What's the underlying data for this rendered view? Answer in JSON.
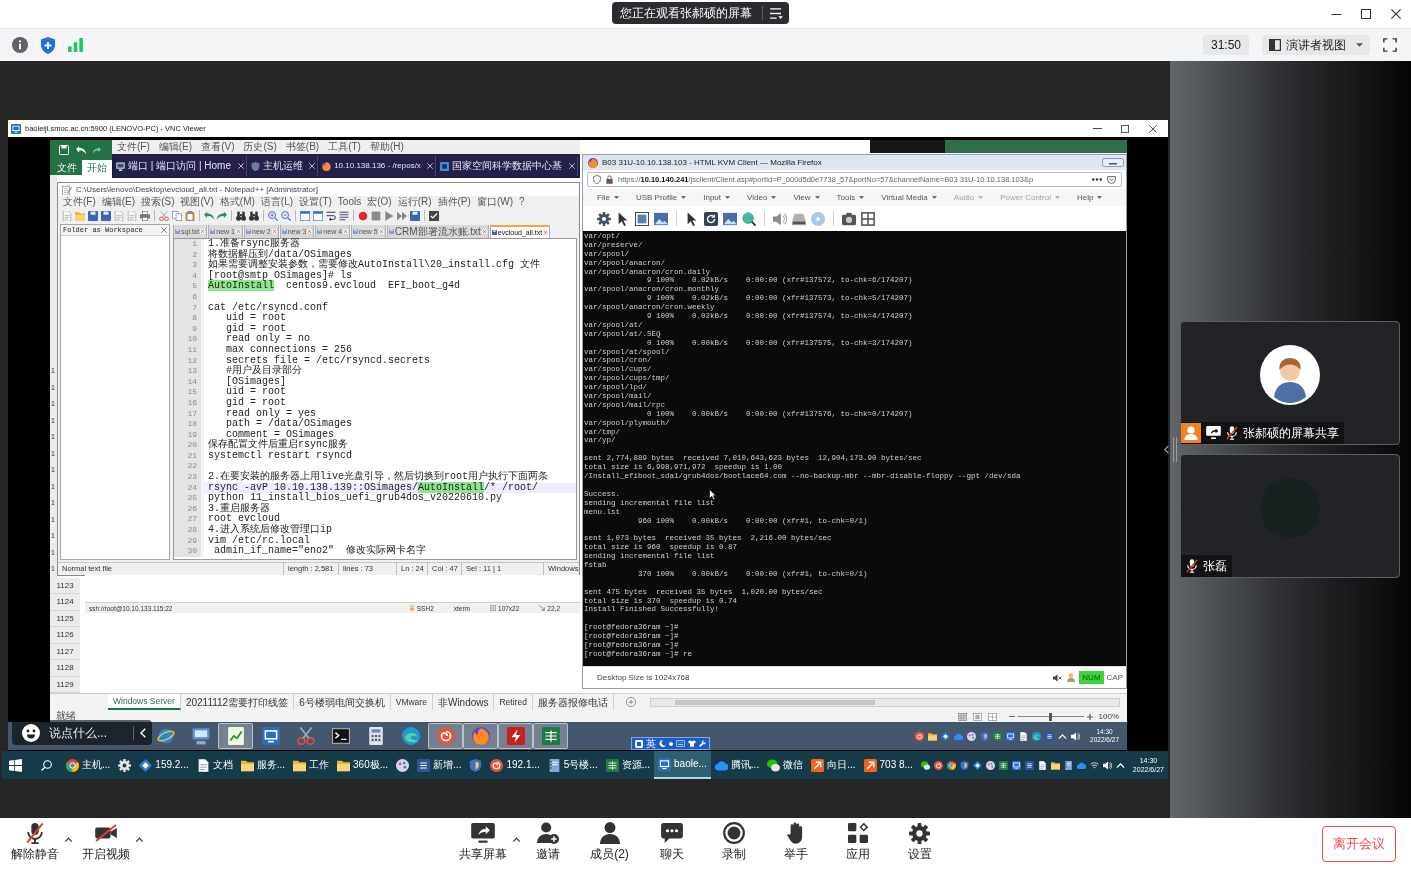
{
  "window": {
    "banner": "您正在观看张郝硕的屏幕"
  },
  "toolbar": {
    "timer": "31:50",
    "view_menu": "演讲者视图"
  },
  "shared_screen": {
    "vnc_window": {
      "title": "baoleiji.smoc.ac.cn:5900 (LENOVO-PC) - VNC Viewer"
    },
    "excel": {
      "ribbon_tabs": [
        {
          "label": "文件",
          "selected": false
        },
        {
          "label": "开始",
          "selected": true
        }
      ],
      "edge_row_numbers": [
        "1",
        "1",
        "1",
        "1",
        "1",
        "1",
        "1",
        "1",
        "1",
        "1",
        "1",
        "1",
        "1"
      ],
      "row_numbers": [
        "1123",
        "1124",
        "1125",
        "1126",
        "1127",
        "1128",
        "1129"
      ],
      "sheet_tabs": [
        {
          "label": "Windows Server",
          "selected": true
        },
        {
          "label": "20211112需要打印线签",
          "selected": false
        },
        {
          "label": "6号楼弱电间交换机",
          "selected": false
        },
        {
          "label": "VMware",
          "selected": false
        },
        {
          "label": "非Windows",
          "selected": false
        },
        {
          "label": "Retired",
          "selected": false
        },
        {
          "label": "服务器报修电话",
          "selected": false
        }
      ],
      "status": "就绪",
      "zoom_slider": {
        "level": 0.5
      },
      "zoom": "100%"
    },
    "browser": {
      "menu": [
        "文件(F)",
        "编辑(E)",
        "查看(V)",
        "历史(S)",
        "书签(B)",
        "工具(T)",
        "帮助(H)"
      ],
      "tabs": [
        {
          "title": "端口 | 端口访问 | Home",
          "kind": "monitor"
        },
        {
          "title": "主机运维",
          "kind": "shield"
        },
        {
          "title": "10.10.138.136 - /repos/x",
          "kind": "flame"
        },
        {
          "title": "国家空间科学数据中心基",
          "kind": "square"
        }
      ]
    },
    "notepad": {
      "title": "C:\\Users\\lenovo\\Desktop\\evcloud_all.txt - Notepad++ [Administrator]",
      "menu": [
        "文件(F)",
        "编辑(E)",
        "搜索(S)",
        "视图(V)",
        "格式(M)",
        "语言(L)",
        "设置(T)",
        "Tools",
        "宏(O)",
        "运行(R)",
        "插件(P)",
        "窗口(W)",
        "?"
      ],
      "panel_title": "Folder as Workspace",
      "tabs": [
        {
          "label": "sql.txt",
          "selected": false
        },
        {
          "label": "new 1",
          "selected": false
        },
        {
          "label": "new 2",
          "selected": false
        },
        {
          "label": "new 3",
          "selected": false
        },
        {
          "label": "new 4",
          "selected": false
        },
        {
          "label": "new 5",
          "selected": false
        },
        {
          "label": "CRM部署流水账.txt",
          "selected": false
        },
        {
          "label": "evcloud_all.txt",
          "selected": true
        }
      ],
      "lines": [
        {
          "no": "1",
          "text": "1.准备rsync服务器",
          "current": false
        },
        {
          "no": "2",
          "text": "将数据解压到/data/OSimages",
          "current": false
        },
        {
          "no": "3",
          "text": "如果需要调整安装参数，需要修改AutoInstall\\20_install.cfg 文件",
          "current": false
        },
        {
          "no": "4",
          "text": "[root@smtp OSimages]# ls",
          "current": false
        },
        {
          "no": "5",
          "parts": [
            {
              "text": "AutoInstall",
              "marked": true
            },
            {
              "text": "  centos9.evcloud  EFI_boot_g4d",
              "marked": false
            }
          ],
          "current": false
        },
        {
          "no": "6",
          "current": false
        },
        {
          "no": "7",
          "text": "cat /etc/rsyncd.conf",
          "current": false
        },
        {
          "no": "8",
          "text": "   uid = root",
          "current": false
        },
        {
          "no": "9",
          "text": "   gid = root",
          "current": false
        },
        {
          "no": "10",
          "text": "   read only = no",
          "current": false
        },
        {
          "no": "11",
          "text": "   max connections = 256",
          "current": false
        },
        {
          "no": "12",
          "text": "   secrets file = /etc/rsyncd.secrets",
          "current": false
        },
        {
          "no": "13",
          "text": "   #用户及目录部分",
          "current": false
        },
        {
          "no": "14",
          "text": "   [OSimages]",
          "current": false
        },
        {
          "no": "15",
          "text": "   uid = root",
          "current": false
        },
        {
          "no": "16",
          "text": "   gid = root",
          "current": false
        },
        {
          "no": "17",
          "text": "   read only = yes",
          "current": false
        },
        {
          "no": "18",
          "text": "   path = /data/OSimages",
          "current": false
        },
        {
          "no": "19",
          "text": "   comment = OSimages",
          "current": false
        },
        {
          "no": "20",
          "text": "保存配置文件后重启rsync服务",
          "current": false
        },
        {
          "no": "21",
          "text": "systemctl restart rsyncd",
          "current": false
        },
        {
          "no": "22",
          "current": false
        },
        {
          "no": "23",
          "text": "2.在要安装的服务器上用live光盘引导，然后切换到root用户执行下面两条",
          "current": false
        },
        {
          "no": "24",
          "parts": [
            {
              "text": "rsync -avP 10.10.138.139::OSimages/",
              "marked": false
            },
            {
              "text": "AutoInstall",
              "marked": true
            },
            {
              "text": "/* /root/",
              "marked": false
            }
          ],
          "current": true
        },
        {
          "no": "25",
          "text": "python 11_install_bios_uefi_grub4dos_v20220610.py",
          "current": false
        },
        {
          "no": "26",
          "text": "3.重启服务器",
          "current": false
        },
        {
          "no": "27",
          "text": "root evcloud",
          "current": false
        },
        {
          "no": "28",
          "text": "4.进入系统后修改管理口ip",
          "current": false
        },
        {
          "no": "29",
          "text": "vim /etc/rc.local",
          "current": false
        },
        {
          "no": "30",
          "text": " admin_if_name=\"eno2\"  修改实际网卡名字",
          "current": false
        }
      ],
      "status": [
        "Normal text file",
        "length : 2,581",
        "lines : 73",
        "Ln : 24",
        "Col : 47",
        "Sel : 11 | 1",
        "Windows"
      ]
    },
    "xshell": {
      "address": "ssh://root@10.10.133.115:22",
      "fields": [
        "SSH2",
        "xterm",
        "107x22",
        "22,2"
      ]
    },
    "firefox": {
      "title": "B03 31U-10.10.138.103 - HTML KVM Client — Mozilla Firefox",
      "url": "https://**10.10.140.241**/jsclient/Client.asp#portId=P_000d5d0e7738_57&portNo=57&channelName=B03 31U-10.10.138.103&p",
      "menu": [
        {
          "label": "File",
          "disabled": false
        },
        {
          "label": "USB Profile",
          "disabled": false
        },
        {
          "label": "Input",
          "disabled": false
        },
        {
          "label": "Video",
          "disabled": false
        },
        {
          "label": "View",
          "disabled": false
        },
        {
          "label": "Tools",
          "disabled": false
        },
        {
          "label": "Virtual Media",
          "disabled": false
        },
        {
          "label": "Audio",
          "disabled": true
        },
        {
          "label": "Power Control",
          "disabled": true
        },
        {
          "label": "Help",
          "disabled": false
        }
      ],
      "terminal": [
        [
          "var/opt/",
          "var/preserve/",
          "var/spool/",
          "var/spool/anacron/",
          "var/spool/anacron/cron.daily",
          "              9 100%    0.02kB/s    0:00:00 (xfr#137572, to-chk=6/174207)",
          "var/spool/anacron/cron.monthly",
          "              9 100%    0.02kB/s    0:00:00 (xfr#137573, to-chk=5/174207)",
          "var/spool/anacron/cron.weekly",
          "              9 100%    0.02kB/s    0:00:00 (xfr#137574, to-chk=4/174207)",
          "var/spool/at/",
          "var/spool/at/.SEQ",
          "              0 100%    0.00kB/s    0:00:00 (xfr#137575, to-chk=3/174207)",
          "var/spool/at/spool/",
          "var/spool/cron/",
          "var/spool/cups/",
          "var/spool/cups/tmp/",
          "var/spool/lpd/",
          "var/spool/mail/",
          "var/spool/mail/rpc",
          "              0 100%    0.00kB/s    0:00:00 (xfr#137576, to-chk=0/174207)",
          "var/spool/plymouth/",
          "var/tmp/",
          "var/yp/"
        ],
        [
          "sent 2,774,889 bytes  received 7,010,643,623 bytes  12,904,173.90 bytes/sec",
          "total size is 6,998,971,972  speedup is 1.00",
          "/Install_efiboot_sda1/grub4dos/bootlace64.com --no-backup-mbr --mbr-disable-floppy --gpt /dev/sda"
        ],
        [
          "Success.",
          "sending incremental file list",
          "menu.lst",
          "            960 100%    0.00kB/s    0:00:00 (xfr#1, to-chk=0/1)"
        ],
        [
          "sent 1,073 bytes  received 35 bytes  2,216.00 bytes/sec",
          "total size is 960  speedup is 0.87",
          "sending incremental file list",
          "fstab",
          "            370 100%    0.00kB/s    0:00:00 (xfr#1, to-chk=0/1)"
        ],
        [
          "sent 475 bytes  received 35 bytes  1,020.00 bytes/sec",
          "total size is 370  speedup is 0.74",
          "Install Finished Successfully!"
        ],
        [
          "[root@fedora36ram ~]#",
          "[root@fedora36ram ~]#",
          "[root@fedora36ram ~]#",
          "[root@fedora36ram ~]# re"
        ]
      ],
      "status": "Desktop Size is 1024x768",
      "indicators": [
        {
          "label": "NUM",
          "on": true
        },
        {
          "label": "CAP",
          "on": false
        }
      ]
    },
    "remote_taskbar": {
      "apps": [
        {
          "kind": "globe",
          "selected": false
        },
        {
          "kind": "computer",
          "selected": false
        },
        {
          "kind": "chart",
          "selected": true
        },
        {
          "kind": "monitor-tile",
          "selected": false
        },
        {
          "kind": "scissors",
          "selected": false
        },
        {
          "kind": "terminal",
          "selected": false
        },
        {
          "kind": "calculator",
          "selected": false
        },
        {
          "kind": "swirl",
          "selected": false
        },
        {
          "kind": "spiral",
          "selected": true
        },
        {
          "kind": "flame",
          "selected": true
        },
        {
          "kind": "bolt-tile",
          "selected": true
        },
        {
          "kind": "spreadsheet",
          "selected": true
        }
      ],
      "ime_mode": "英",
      "time": "14:30",
      "date": "2022/6/27"
    },
    "taskbar": {
      "items": [
        {
          "kind": "segmented-circle",
          "label": "主机...",
          "selected": false
        },
        {
          "kind": "gear",
          "selected": false
        },
        {
          "kind": "diamond",
          "label": "159.2...",
          "selected": false
        },
        {
          "kind": "document",
          "label": "文档",
          "selected": false
        },
        {
          "kind": "folder",
          "label": "服务...",
          "selected": false
        },
        {
          "kind": "folder",
          "label": "工作",
          "selected": false
        },
        {
          "kind": "folder",
          "label": "360极...",
          "selected": false
        },
        {
          "kind": "palette",
          "selected": false
        },
        {
          "kind": "document-tile",
          "label": "新增...",
          "selected": false
        },
        {
          "kind": "shield",
          "selected": false
        },
        {
          "kind": "spiral",
          "label": "192.1...",
          "selected": false
        },
        {
          "kind": "notebook",
          "label": "5号楼...",
          "selected": false
        },
        {
          "kind": "spreadsheet",
          "label": "资源...",
          "selected": false
        },
        {
          "kind": "monitor-tile",
          "label": "baole...",
          "selected": true
        },
        {
          "kind": "cloud",
          "label": "腾讯...",
          "selected": false
        },
        {
          "kind": "chat-bubbles",
          "label": "微信",
          "selected": false
        },
        {
          "kind": "arrow-tile",
          "label": "向日...",
          "selected": false
        },
        {
          "kind": "arrow-tile",
          "label": "703 8...",
          "selected": false
        }
      ],
      "time": "14:30",
      "date": "2022/6/27"
    }
  },
  "chat": {
    "placeholder": "说点什么..."
  },
  "participants": [
    {
      "name": "张郝硕的屏幕共享",
      "kind": "drawing",
      "host": true,
      "sharing": true,
      "muted": true
    },
    {
      "name": "张磊",
      "kind": "photo",
      "host": false,
      "sharing": false,
      "muted": true
    }
  ],
  "controls": {
    "left": [
      {
        "label": "解除静音",
        "kind": "mic",
        "menu": true
      },
      {
        "label": "开启视频",
        "kind": "camera",
        "menu": true
      }
    ],
    "center": [
      {
        "label": "共享屏幕",
        "kind": "share",
        "menu": true
      },
      {
        "label": "邀请",
        "kind": "invite",
        "menu": false
      },
      {
        "label": "成员(2)",
        "kind": "members",
        "menu": false
      },
      {
        "label": "聊天",
        "kind": "chat",
        "menu": false
      },
      {
        "label": "录制",
        "kind": "record",
        "menu": false
      },
      {
        "label": "举手",
        "kind": "hand",
        "menu": false
      },
      {
        "label": "应用",
        "kind": "apps",
        "menu": false
      },
      {
        "label": "设置",
        "kind": "settings",
        "menu": false
      }
    ],
    "leave": "离开会议"
  }
}
